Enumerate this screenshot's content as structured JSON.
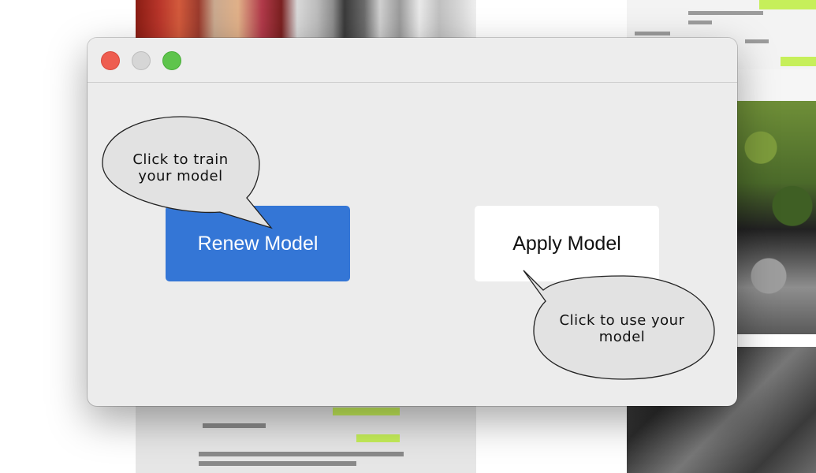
{
  "window": {
    "controls": {
      "close_color": "#ee5d50",
      "minimize_color": "#d6d6d6",
      "zoom_color": "#5ec44c"
    }
  },
  "buttons": {
    "renew": {
      "label": "Renew Model",
      "color": "#3476d6"
    },
    "apply": {
      "label": "Apply Model",
      "color": "#ffffff"
    }
  },
  "tooltips": {
    "train": {
      "lines": [
        "Click to train",
        "your model"
      ]
    },
    "use": {
      "lines": [
        "Click to use your",
        "model"
      ]
    }
  }
}
